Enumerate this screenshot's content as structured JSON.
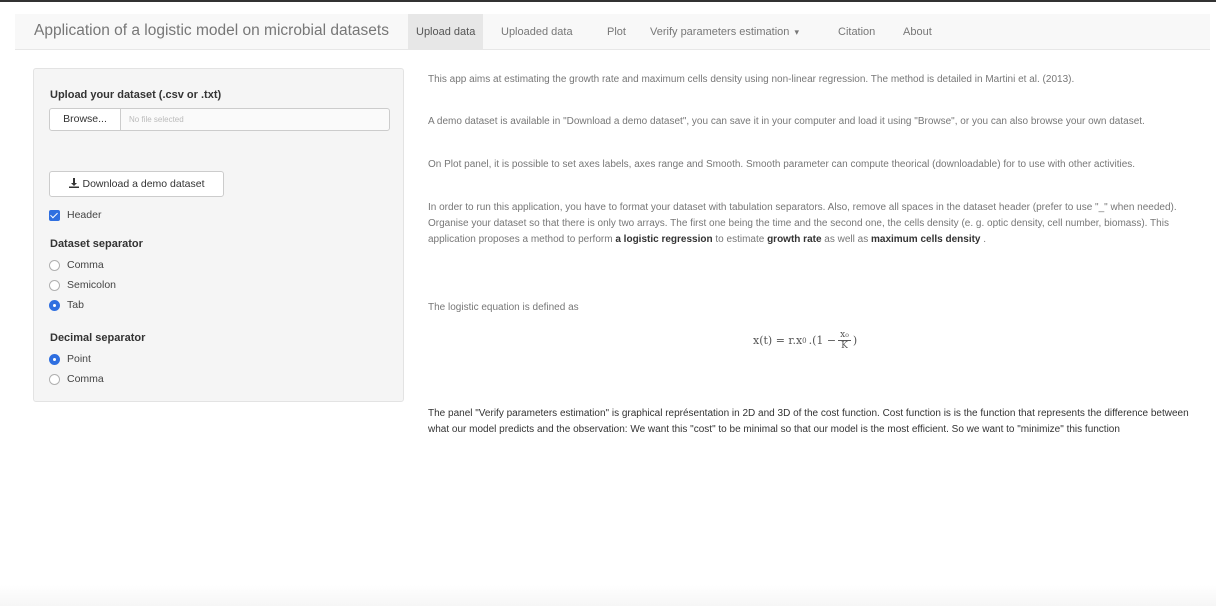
{
  "navbar": {
    "brand": "Application of a logistic model on microbial datasets",
    "tabs": [
      {
        "label": "Upload data",
        "active": true
      },
      {
        "label": "Uploaded data"
      },
      {
        "label": "Plot"
      },
      {
        "label": "Verify parameters estimation",
        "dropdown": true
      },
      {
        "label": "Citation"
      },
      {
        "label": "About"
      }
    ]
  },
  "sidebar": {
    "upload_label": "Upload your dataset (.csv or .txt)",
    "browse_label": "Browse...",
    "file_placeholder": "No file selected",
    "demo_button": "Download a demo dataset",
    "header_label": "Header",
    "dataset_separator_label": "Dataset separator",
    "dataset_separator_options": [
      "Comma",
      "Semicolon",
      "Tab"
    ],
    "dataset_separator_selected": "Tab",
    "decimal_separator_label": "Decimal separator",
    "decimal_separator_options": [
      "Point",
      "Comma"
    ],
    "decimal_separator_selected": "Point"
  },
  "main": {
    "p1": "This app aims at estimating the growth rate and maximum cells density using non-linear regression. The method is detailed in Martini et al. (2013).",
    "p2": "A demo dataset is available in \"Download a demo dataset\", you can save it in your computer and load it using \"Browse\", or you can also browse your own dataset.",
    "p3": "On Plot panel, it is possible to set axes labels, axes range and Smooth. Smooth parameter can compute theorical (downloadable) for to use with other activities.",
    "p4_a": "In order to run this application, you have to format your dataset with tabulation separators. Also, remove all spaces in the dataset header (prefer to use \"_\" when needed). Organise your dataset so that there is only two arrays. The first one being the time and the second one, the cells density (e. g. optic density, cell number, biomass). This application proposes a method to perform ",
    "p4_b1": "a logistic regression",
    "p4_c": " to estimate ",
    "p4_b2": "growth rate",
    "p4_d": " as well as ",
    "p4_b3": "maximum cells density",
    "p4_e": " .",
    "p5": "The logistic equation is defined as",
    "eq_lhs": "x(t) = r.x",
    "eq_sub": "0",
    "eq_mid": ".(1 −",
    "eq_num": "x₀",
    "eq_den": "K",
    "eq_end": ")",
    "p6": "The panel \"Verify parameters estimation\" is graphical représentation in 2D and 3D of the cost function. Cost function is is the function that represents the difference between what our model predicts and the observation: We want this \"cost\" to be minimal so that our model is the most efficient. So we want to \"minimize\" this function"
  },
  "icons": {
    "download": "download-icon",
    "caret": "caret-down-icon"
  }
}
